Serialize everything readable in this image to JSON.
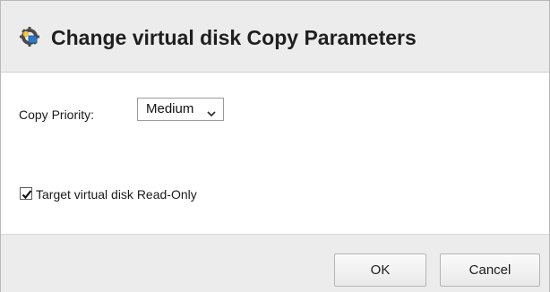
{
  "dialog": {
    "title": "Change virtual disk Copy Parameters",
    "title_icon": "virtual-disk-copy-icon"
  },
  "form": {
    "priority_label": "Copy Priority:",
    "priority_value": "Medium",
    "priority_options_visible": [
      "Medium"
    ],
    "read_only_label": "Target virtual disk Read-Only",
    "read_only_checked": true
  },
  "buttons": {
    "ok_label": "OK",
    "cancel_label": "Cancel"
  },
  "colors": {
    "titlebar_bg": "#ececec",
    "footer_bg": "#ececec",
    "button_border": "#b5b5b5",
    "icon_blue": "#2f78c4",
    "icon_yellow": "#f2c640"
  }
}
